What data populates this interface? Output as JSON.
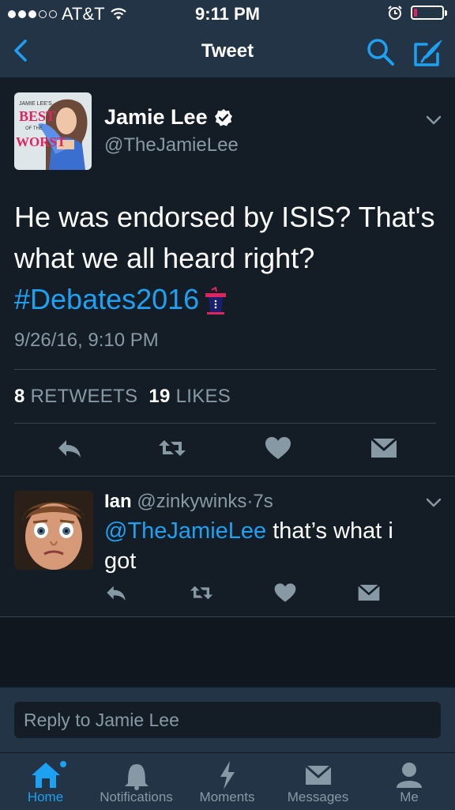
{
  "status_bar": {
    "carrier": "AT&T",
    "time": "9:11 PM",
    "signal_dots_filled": 3,
    "signal_dots_total": 5,
    "battery_level": 0.12
  },
  "nav": {
    "title": "Tweet",
    "back_icon": "chevron-left-icon",
    "search_icon": "search-icon",
    "compose_icon": "compose-icon"
  },
  "tweet": {
    "author_name": "Jamie Lee",
    "verified": true,
    "author_handle": "@TheJamieLee",
    "avatar_text": {
      "line1": "JAMIE LEE'S",
      "line2": "BEST",
      "line3": "OF THE",
      "line4": "WORST"
    },
    "text_line1": "He was endorsed by ISIS? That's",
    "text_line2": "what we all heard right?",
    "hashtag": "#Debates2016",
    "timestamp": "9/26/16, 9:10 PM",
    "retweets_count": "8",
    "retweets_label": "RETWEETS",
    "likes_count": "19",
    "likes_label": "LIKES",
    "actions": [
      "reply-icon",
      "retweet-icon",
      "like-icon",
      "direct-message-icon"
    ]
  },
  "reply": {
    "author_name": "Ian",
    "author_handle": "@zinkywinks",
    "separator": "·",
    "age": "7s",
    "mention": "@TheJamieLee",
    "text_after_mention": " that’s what i",
    "text_line2": "got",
    "actions": [
      "reply-icon",
      "retweet-icon",
      "like-icon",
      "direct-message-icon"
    ]
  },
  "reply_box": {
    "placeholder": "Reply to Jamie Lee"
  },
  "tab_bar": {
    "tabs": [
      {
        "label": "Home",
        "icon": "home-icon",
        "active": true
      },
      {
        "label": "Notifications",
        "icon": "bell-icon",
        "active": false
      },
      {
        "label": "Moments",
        "icon": "lightning-icon",
        "active": false
      },
      {
        "label": "Messages",
        "icon": "envelope-icon",
        "active": false
      },
      {
        "label": "Me",
        "icon": "person-icon",
        "active": false
      }
    ]
  },
  "colors": {
    "background": "#141d26",
    "bar": "#243447",
    "accent": "#1da1f2",
    "secondary_text": "#8899a6",
    "battery_low": "#e0245e"
  }
}
